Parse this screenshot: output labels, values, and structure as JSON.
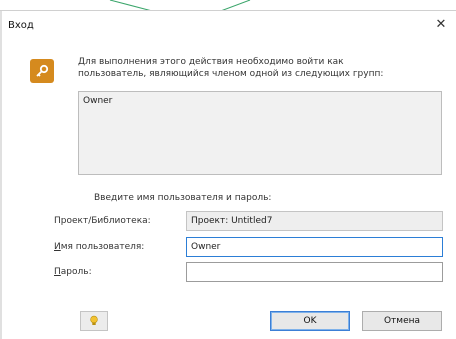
{
  "window": {
    "title": "Вход"
  },
  "message": {
    "line1": "Для выполнения этого действия необходимо войти как",
    "line2": "пользователь, являющийся членом одной из следующих групп:"
  },
  "groups": [
    "Owner"
  ],
  "prompt": "Введите имя пользователя и пароль:",
  "fields": {
    "project_label": "Проект/Библиотека:",
    "project_value": "Проект: Untitled7",
    "username_label_accel": "И",
    "username_label_rest": "мя пользователя:",
    "username_value": "Owner",
    "password_label_accel": "П",
    "password_label_rest": "ароль:",
    "password_value": ""
  },
  "buttons": {
    "ok": "OK",
    "cancel": "Отмена"
  },
  "colors": {
    "key_icon_bg": "#d58a1e",
    "focus_border": "#2c7ed6",
    "bg_lines": "#3aa56a"
  }
}
